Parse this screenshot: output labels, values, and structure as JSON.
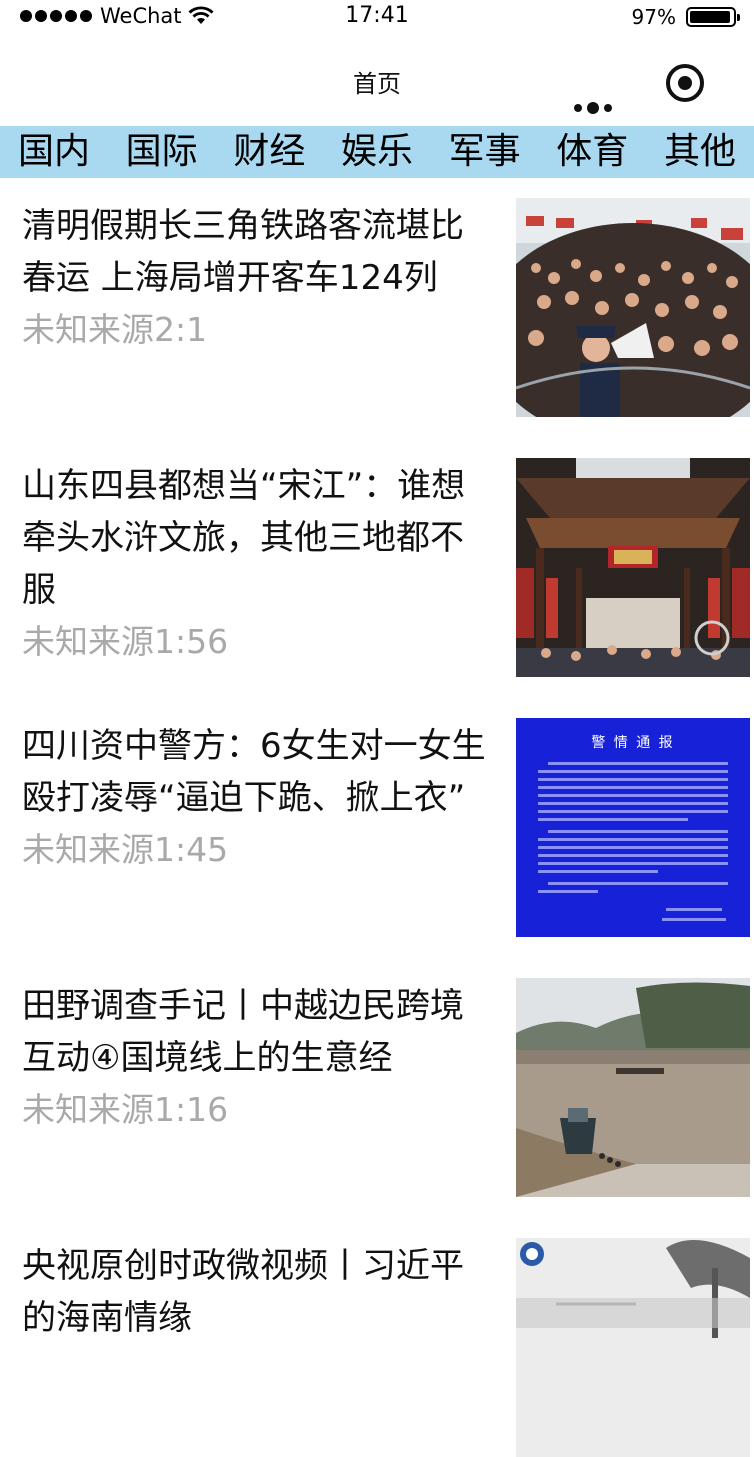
{
  "status": {
    "carrier": "WeChat",
    "time": "17:41",
    "battery": "97%"
  },
  "nav": {
    "title": "首页"
  },
  "tabs": [
    "国内",
    "国际",
    "财经",
    "娱乐",
    "军事",
    "体育",
    "其他"
  ],
  "news": [
    {
      "title": "清明假期长三角铁路客流堪比春运 上海局增开客车124列",
      "source": "未知来源",
      "time": "2:1",
      "image": "train-station-crowd"
    },
    {
      "title": "山东四县都想当“宋江”：谁想牵头水浒文旅，其他三地都不服",
      "source": "未知来源",
      "time": "1:56",
      "image": "ancient-hall-interior"
    },
    {
      "title": "四川资中警方：6女生对一女生殴打凌辱“逼迫下跪、掀上衣”",
      "source": "未知来源",
      "time": "1:45",
      "image": "police-notice-blue"
    },
    {
      "title": "田野调查手记丨中越边民跨境互动④国境线上的生意经",
      "source": "未知来源",
      "time": "1:16",
      "image": "border-river-boats"
    },
    {
      "title": "央视原创时政微视频丨习近平的海南情缘",
      "source": "",
      "time": "",
      "image": "hainan-video"
    }
  ],
  "police_notice": {
    "heading": "警 情 通 报"
  }
}
